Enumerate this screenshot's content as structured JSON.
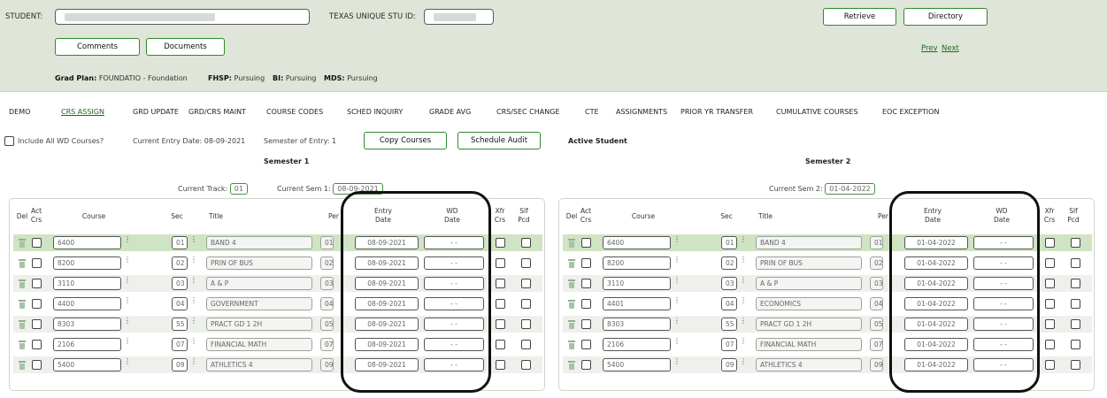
{
  "header": {
    "student_label": "STUDENT:",
    "texas_id_label": "TEXAS UNIQUE STU ID:",
    "retrieve": "Retrieve",
    "directory": "Directory",
    "comments": "Comments",
    "documents": "Documents",
    "prev": "Prev",
    "next": "Next",
    "grad_plan_label": "Grad Plan:",
    "grad_plan_value": "FOUNDATIO - Foundation",
    "fhsp_label": "FHSP:",
    "fhsp_value": "Pursuing",
    "bi_label": "BI:",
    "bi_value": "Pursuing",
    "mds_label": "MDS:",
    "mds_value": "Pursuing"
  },
  "tabs": [
    "DEMO",
    "CRS ASSIGN",
    "GRD UPDATE",
    "GRD/CRS MAINT",
    "COURSE CODES",
    "SCHED INQUIRY",
    "GRADE AVG",
    "CRS/SEC CHANGE",
    "CTE",
    "ASSIGNMENTS",
    "PRIOR YR TRANSFER",
    "CUMULATIVE COURSES",
    "EOC EXCEPTION"
  ],
  "info": {
    "include_wd": "Include All WD Courses?",
    "entry_date": "Current Entry Date: 08-09-2021",
    "sem_entry": "Semester of Entry: 1",
    "copy_courses": "Copy Courses",
    "schedule_audit": "Schedule Audit",
    "active_student": "Active Student"
  },
  "headers": {
    "del": "Del",
    "act": "Act",
    "crs": "Crs",
    "course": "Course",
    "sec": "Sec",
    "title": "Title",
    "per": "Per",
    "entry": "Entry",
    "date": "Date",
    "wd": "WD",
    "xfr": "Xfr",
    "slf": "Slf",
    "pcd": "Pcd"
  },
  "semester1": {
    "title": "Semester 1",
    "current_track_label": "Current Track:",
    "current_track": "01",
    "current_sem_label": "Current Sem 1:",
    "current_sem": "08-09-2021",
    "rows": [
      {
        "course": "6400",
        "sec": "01",
        "title": "BAND 4",
        "per": "01",
        "entry": "08-09-2021",
        "wd": "- -"
      },
      {
        "course": "8200",
        "sec": "02",
        "title": "PRIN OF BUS",
        "per": "02",
        "entry": "08-09-2021",
        "wd": "- -"
      },
      {
        "course": "3110",
        "sec": "03",
        "title": "A & P",
        "per": "03",
        "entry": "08-09-2021",
        "wd": "- -"
      },
      {
        "course": "4400",
        "sec": "04",
        "title": "GOVERNMENT",
        "per": "04",
        "entry": "08-09-2021",
        "wd": "- -"
      },
      {
        "course": "8303",
        "sec": "55",
        "title": "PRACT GD 1 2H",
        "per": "05",
        "entry": "08-09-2021",
        "wd": "- -"
      },
      {
        "course": "2106",
        "sec": "07",
        "title": "FINANCIAL MATH",
        "per": "07",
        "entry": "08-09-2021",
        "wd": "- -"
      },
      {
        "course": "5400",
        "sec": "09",
        "title": "ATHLETICS 4",
        "per": "09",
        "entry": "08-09-2021",
        "wd": "- -"
      }
    ]
  },
  "semester2": {
    "title": "Semester 2",
    "current_sem_label": "Current Sem 2:",
    "current_sem": "01-04-2022",
    "rows": [
      {
        "course": "6400",
        "sec": "01",
        "title": "BAND 4",
        "per": "01",
        "entry": "01-04-2022",
        "wd": "- -"
      },
      {
        "course": "8200",
        "sec": "02",
        "title": "PRIN OF BUS",
        "per": "02",
        "entry": "01-04-2022",
        "wd": "- -"
      },
      {
        "course": "3110",
        "sec": "03",
        "title": "A & P",
        "per": "03",
        "entry": "01-04-2022",
        "wd": "- -"
      },
      {
        "course": "4401",
        "sec": "04",
        "title": "ECONOMICS",
        "per": "04",
        "entry": "01-04-2022",
        "wd": "- -"
      },
      {
        "course": "8303",
        "sec": "55",
        "title": "PRACT GD 1 2H",
        "per": "05",
        "entry": "01-04-2022",
        "wd": "- -"
      },
      {
        "course": "2106",
        "sec": "07",
        "title": "FINANCIAL MATH",
        "per": "07",
        "entry": "01-04-2022",
        "wd": "- -"
      },
      {
        "course": "5400",
        "sec": "09",
        "title": "ATHLETICS 4",
        "per": "09",
        "entry": "01-04-2022",
        "wd": "- -"
      }
    ]
  },
  "colors": {
    "accent": "#2f8a2f",
    "header_bg": "#dfe5d8",
    "first_row": "#cfe4c3"
  }
}
